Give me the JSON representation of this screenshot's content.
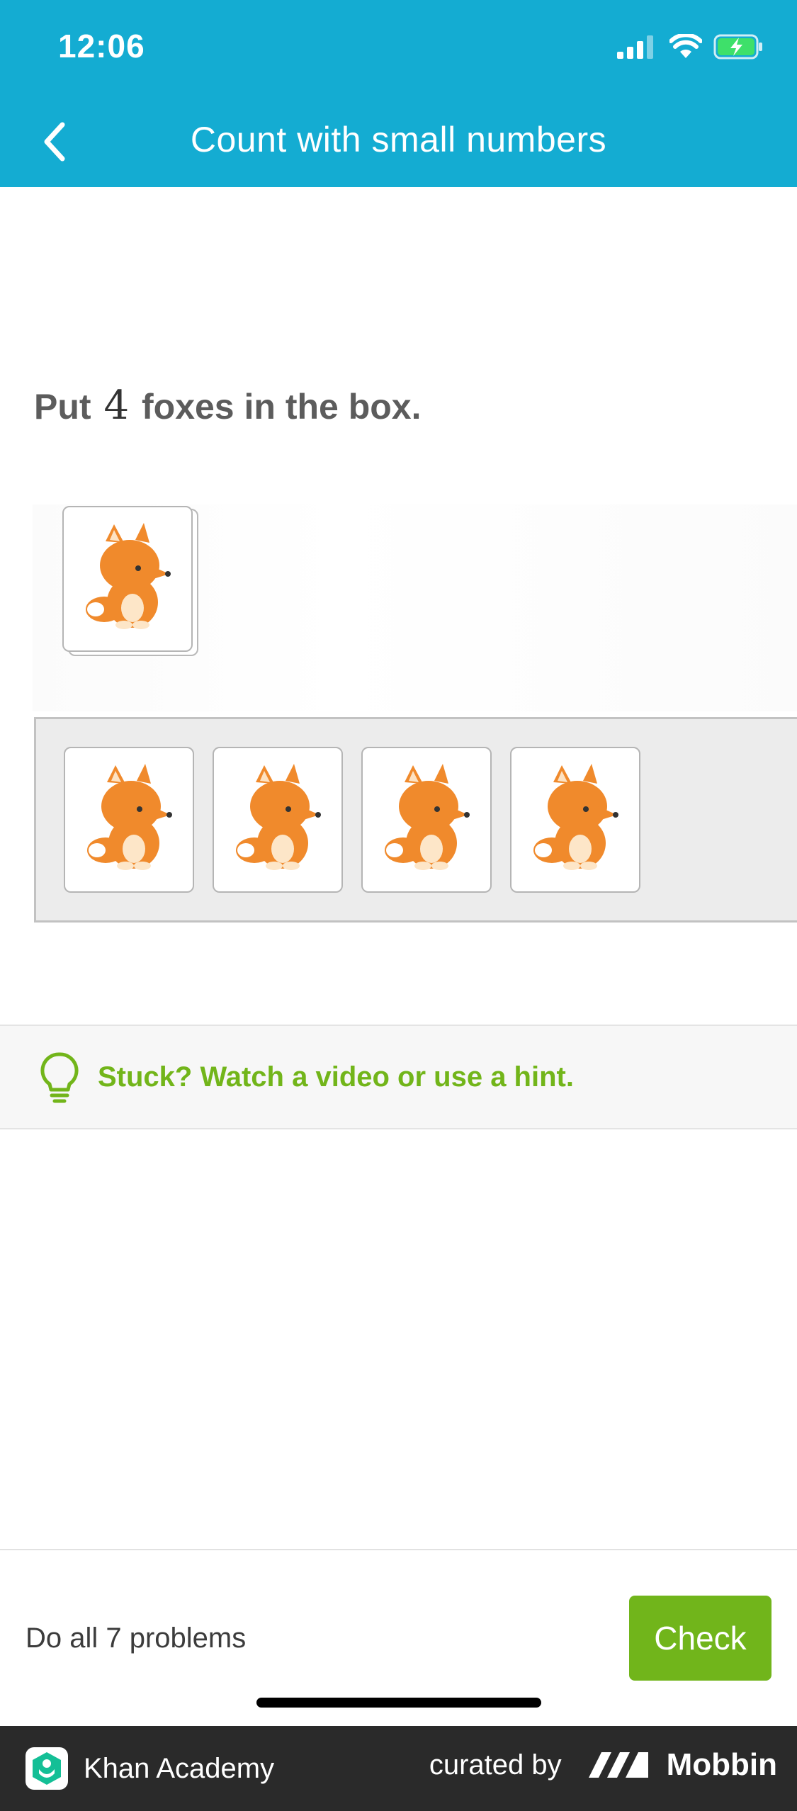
{
  "status_bar": {
    "time": "12:06"
  },
  "nav": {
    "title": "Count with small numbers"
  },
  "question": {
    "prefix": "Put",
    "number": "4",
    "suffix": "foxes in the box."
  },
  "cards": {
    "stack_item": "fox-card",
    "tray_items": [
      "fox-card",
      "fox-card",
      "fox-card",
      "fox-card"
    ]
  },
  "hint": {
    "text": "Stuck? Watch a video or use a hint."
  },
  "footer": {
    "progress": "Do all 7 problems",
    "check_label": "Check"
  },
  "branding": {
    "app_name": "Khan Academy",
    "curated_by": "curated by",
    "curator": "Mobbin"
  },
  "colors": {
    "header_bg": "#14acd2",
    "hint_green": "#72b51a",
    "check_green": "#71b51b",
    "fox_orange": "#f08a2c"
  }
}
